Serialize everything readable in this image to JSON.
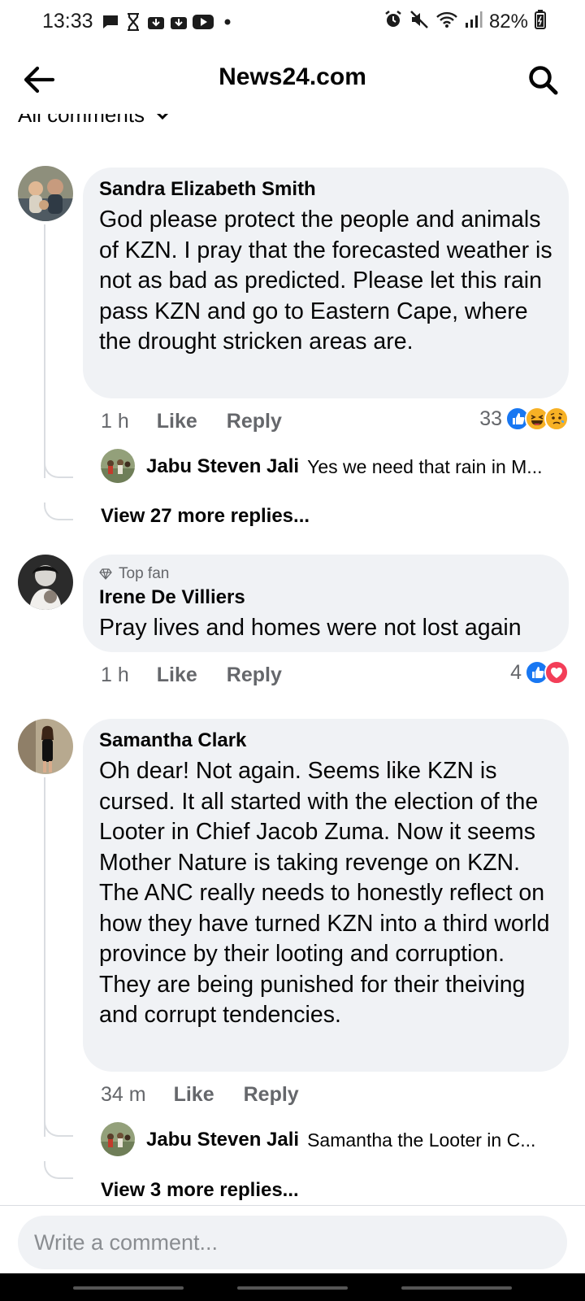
{
  "status_bar": {
    "time": "13:33",
    "battery": "82%",
    "notification_icons": [
      "message-icon",
      "hourglass-icon",
      "download-icon",
      "download-icon",
      "youtube-icon",
      "dot-icon"
    ],
    "system_icons": [
      "alarm-icon",
      "mute-icon",
      "wifi-icon",
      "signal-icon",
      "battery-icon"
    ]
  },
  "header": {
    "title": "News24.com",
    "back_icon": "arrow-left-icon",
    "search_icon": "search-icon"
  },
  "filter": {
    "label": "All comments"
  },
  "comments": [
    {
      "author": "Sandra Elizabeth Smith",
      "text": "God please protect the people and animals of KZN. I pray that the forecasted weather is not as bad as predicted. Please let this rain pass KZN and go to Eastern Cape, where the drought stricken areas are.",
      "time": "1 h",
      "like": "Like",
      "reply": "Reply",
      "reaction_count": "33",
      "reactions": [
        "like",
        "haha",
        "sad"
      ],
      "reply_preview": {
        "author": "Jabu Steven Jali",
        "text": "Yes we need that rain in M..."
      },
      "view_more": "View 27 more replies..."
    },
    {
      "badge": "Top fan",
      "author": "Irene De Villiers",
      "text": "Pray lives and homes were not lost again",
      "time": "1 h",
      "like": "Like",
      "reply": "Reply",
      "reaction_count": "4",
      "reactions": [
        "like",
        "love"
      ]
    },
    {
      "author": "Samantha Clark",
      "text": "Oh dear! Not again. Seems like KZN is cursed. It all started with the election of the Looter in Chief Jacob Zuma. Now it seems Mother Nature is taking revenge on KZN. The ANC really needs to honestly reflect on how they have turned KZN into a third world province by their looting and corruption. They are being punished for their theiving and corrupt tendencies.",
      "time": "34 m",
      "like": "Like",
      "reply": "Reply",
      "reply_preview": {
        "author": "Jabu Steven Jali",
        "text": "Samantha the Looter in C..."
      },
      "view_more": "View 3 more replies..."
    }
  ],
  "composer": {
    "placeholder": "Write a comment..."
  },
  "colors": {
    "bubble": "#f0f2f5",
    "secondary_text": "#65676b",
    "like_blue": "#1877f2",
    "love_red": "#f33e58",
    "emoji_yellow": "#f7b125"
  }
}
